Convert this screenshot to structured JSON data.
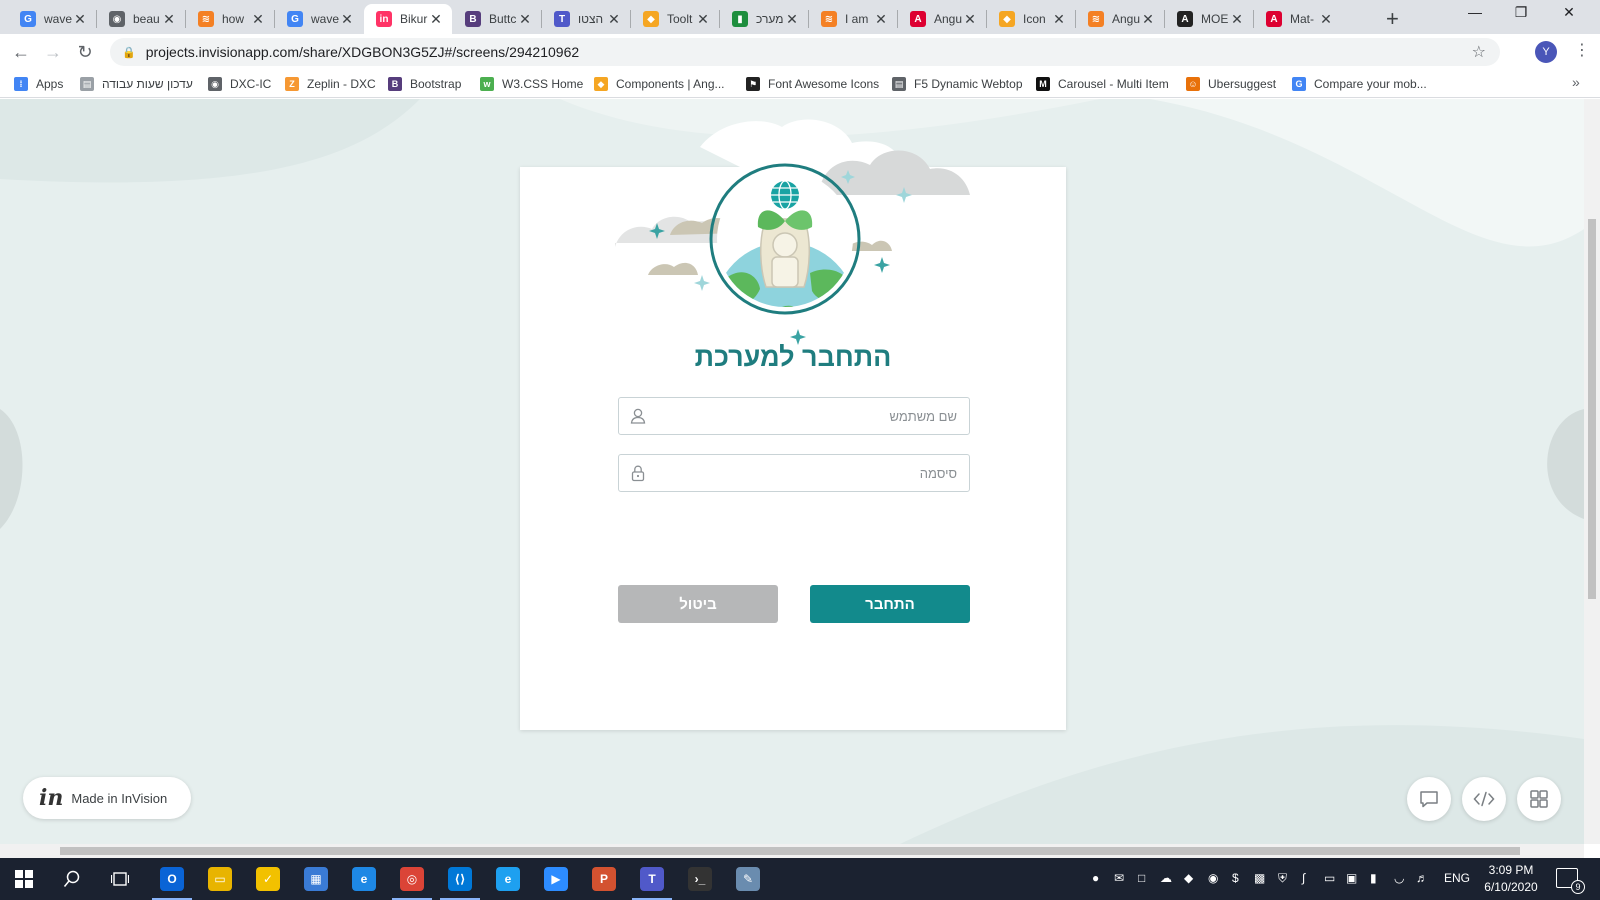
{
  "browser": {
    "tabs": [
      {
        "title": "wave",
        "favicon": "google-icon",
        "color": "#4285f4",
        "glyph": "G"
      },
      {
        "title": "beau",
        "favicon": "globe-icon",
        "color": "#5f6368",
        "glyph": "◉"
      },
      {
        "title": "how",
        "favicon": "stackoverflow-icon",
        "color": "#f48024",
        "glyph": "≋"
      },
      {
        "title": "wave",
        "favicon": "google-icon",
        "color": "#4285f4",
        "glyph": "G"
      },
      {
        "title": "Bikur",
        "favicon": "invision-icon",
        "color": "#ff3366",
        "glyph": "in"
      },
      {
        "title": "Buttc",
        "favicon": "bootstrap-icon",
        "color": "#563d7c",
        "glyph": "B"
      },
      {
        "title": "הצטו",
        "favicon": "teams-icon",
        "color": "#5059c9",
        "glyph": "T"
      },
      {
        "title": "Toolt",
        "favicon": "angular-shield-icon",
        "color": "#f5a623",
        "glyph": "◆"
      },
      {
        "title": "מערכ",
        "favicon": "flag-icon",
        "color": "#1e8e3e",
        "glyph": "▮"
      },
      {
        "title": "I am",
        "favicon": "stackoverflow-icon",
        "color": "#f48024",
        "glyph": "≋"
      },
      {
        "title": "Angu",
        "favicon": "angular-icon",
        "color": "#dd0031",
        "glyph": "A"
      },
      {
        "title": "Icon",
        "favicon": "angular-shield-icon",
        "color": "#f5a623",
        "glyph": "◆"
      },
      {
        "title": "Angu",
        "favicon": "stackoverflow-icon",
        "color": "#f48024",
        "glyph": "≋"
      },
      {
        "title": "MOE",
        "favicon": "angular-black-icon",
        "color": "#222222",
        "glyph": "A"
      },
      {
        "title": "Mat-",
        "favicon": "angular-material-icon",
        "color": "#dd0031",
        "glyph": "A"
      }
    ],
    "active_tab_index": 4,
    "url": "projects.invisionapp.com/share/XDGBON3G5ZJ#/screens/294210962",
    "profile_initial": "Y"
  },
  "bookmarks": [
    {
      "label": "Apps",
      "icon": "apps-grid-icon",
      "color": "#4285f4",
      "glyph": "⁞"
    },
    {
      "label": "עדכון שעות עבודה",
      "icon": "page-icon",
      "color": "#9aa0a6",
      "glyph": "▤"
    },
    {
      "label": "DXC-IC",
      "icon": "globe-icon",
      "color": "#5f6368",
      "glyph": "◉"
    },
    {
      "label": "Zeplin - DXC",
      "icon": "zeplin-icon",
      "color": "#f69833",
      "glyph": "Z"
    },
    {
      "label": "Bootstrap",
      "icon": "bootstrap-icon",
      "color": "#563d7c",
      "glyph": "B"
    },
    {
      "label": "W3.CSS Home",
      "icon": "w3-icon",
      "color": "#4caf50",
      "glyph": "w"
    },
    {
      "label": "Components | Ang...",
      "icon": "angular-shield-icon",
      "color": "#f5a623",
      "glyph": "◆"
    },
    {
      "label": "Font Awesome Icons",
      "icon": "flag-icon",
      "color": "#222222",
      "glyph": "⚑"
    },
    {
      "label": "F5 Dynamic Webtop",
      "icon": "page-icon",
      "color": "#5f6368",
      "glyph": "▤"
    },
    {
      "label": "Carousel - Multi Item",
      "icon": "medium-icon",
      "color": "#111111",
      "glyph": "M"
    },
    {
      "label": "Ubersuggest",
      "icon": "ubersuggest-icon",
      "color": "#e8710a",
      "glyph": "☺"
    },
    {
      "label": "Compare your mob...",
      "icon": "google-icon",
      "color": "#4285f4",
      "glyph": "G"
    }
  ],
  "login": {
    "heading": "התחבר למערכת",
    "username_placeholder": "שם משתמש",
    "password_placeholder": "סיסמה",
    "login_button": "התחבר",
    "cancel_button": "ביטול"
  },
  "invision": {
    "badge_text": "Made in InVision",
    "logo_glyph": "in"
  },
  "colors": {
    "accent": "#128a8c",
    "heading": "#1f7d7f",
    "cancel": "#b6b7b8",
    "background": "#e6efee"
  },
  "taskbar": {
    "apps": [
      {
        "name": "outlook",
        "color": "#0a64d6",
        "glyph": "O",
        "open": true
      },
      {
        "name": "file-explorer",
        "color": "#e8b400",
        "glyph": "▭",
        "open": false
      },
      {
        "name": "norton",
        "color": "#f2c100",
        "glyph": "✓",
        "open": false
      },
      {
        "name": "store",
        "color": "#3a7bd5",
        "glyph": "▦",
        "open": false
      },
      {
        "name": "edge",
        "color": "#1e88e5",
        "glyph": "e",
        "open": false
      },
      {
        "name": "chrome",
        "color": "#db4437",
        "glyph": "◎",
        "open": true
      },
      {
        "name": "vscode",
        "color": "#0078d7",
        "glyph": "⟨⟩",
        "open": true
      },
      {
        "name": "internet-explorer",
        "color": "#1ea0f0",
        "glyph": "e",
        "open": false
      },
      {
        "name": "zoom",
        "color": "#2d8cff",
        "glyph": "▶",
        "open": false
      },
      {
        "name": "powerpoint",
        "color": "#d35230",
        "glyph": "P",
        "open": false
      },
      {
        "name": "teams",
        "color": "#5059c9",
        "glyph": "T",
        "open": true
      },
      {
        "name": "terminal",
        "color": "#333333",
        "glyph": "›_",
        "open": false
      },
      {
        "name": "paint",
        "color": "#6a8caf",
        "glyph": "✎",
        "open": false
      }
    ],
    "language": "ENG",
    "time": "3:09 PM",
    "date": "6/10/2020",
    "notifications": "9"
  }
}
